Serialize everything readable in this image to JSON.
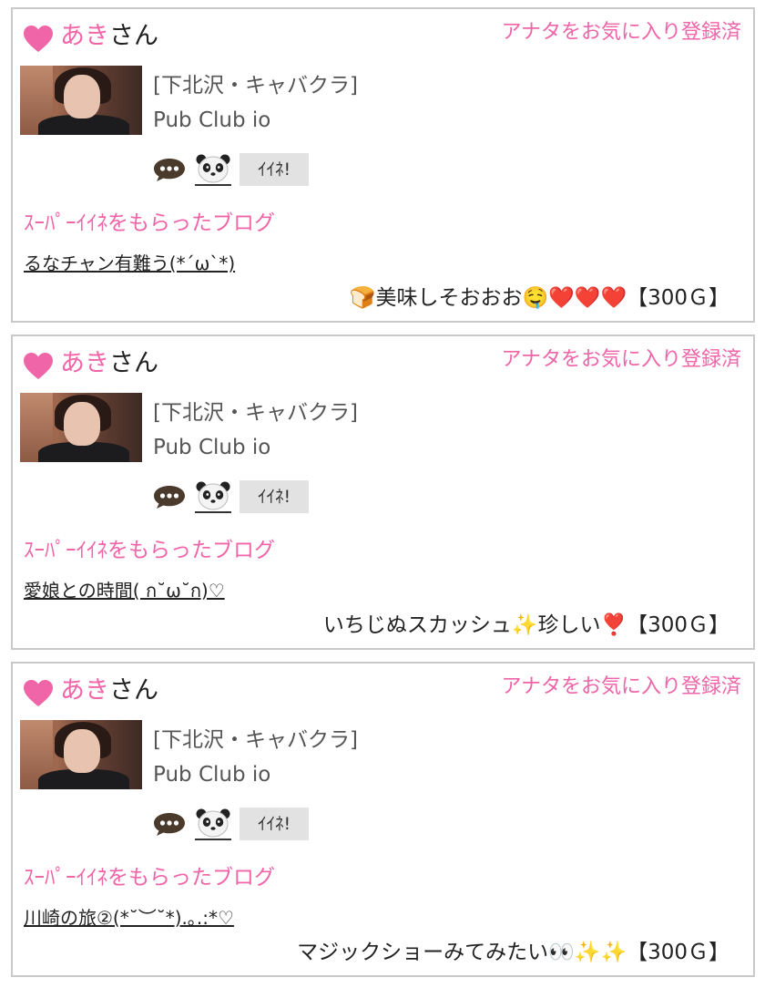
{
  "posts": [
    {
      "name": "あき",
      "name_suffix": "さん",
      "favorite_status": "アナタをお気に入り登録済",
      "shop_category": "[下北沢・キャバクラ]",
      "shop_name": "Pub Club io",
      "iine_label": "ｲｲﾈ!",
      "super_label": "ｽｰﾊﾟｰｲｲﾈをもらったブログ",
      "blog_title": "るなチャン有難う(*´ω`*)",
      "comment": "🍞美味しそおおお🤤❤️❤️❤️",
      "price": "【300Ｇ】"
    },
    {
      "name": "あき",
      "name_suffix": "さん",
      "favorite_status": "アナタをお気に入り登録済",
      "shop_category": "[下北沢・キャバクラ]",
      "shop_name": "Pub Club io",
      "iine_label": "ｲｲﾈ!",
      "super_label": "ｽｰﾊﾟｰｲｲﾈをもらったブログ",
      "blog_title": "愛娘との時間( ก˘ω˘ก)♡",
      "comment": "いちじぬスカッシュ✨珍しい❣️",
      "price": "【300Ｇ】"
    },
    {
      "name": "あき",
      "name_suffix": "さん",
      "favorite_status": "アナタをお気に入り登録済",
      "shop_category": "[下北沢・キャバクラ]",
      "shop_name": "Pub Club io",
      "iine_label": "ｲｲﾈ!",
      "super_label": "ｽｰﾊﾟｰｲｲﾈをもらったブログ",
      "blog_title": "川崎の旅②(*˘︶˘*).｡.:*♡",
      "comment": "マジックショーみてみたい👀✨✨",
      "price": "【300Ｇ】"
    }
  ],
  "colors": {
    "accent_pink": "#f064a8",
    "border": "#c9c9c9",
    "button_bg": "#e2e2e2"
  },
  "icons": [
    "heart-icon",
    "chat-bubble-icon",
    "panda-icon"
  ]
}
